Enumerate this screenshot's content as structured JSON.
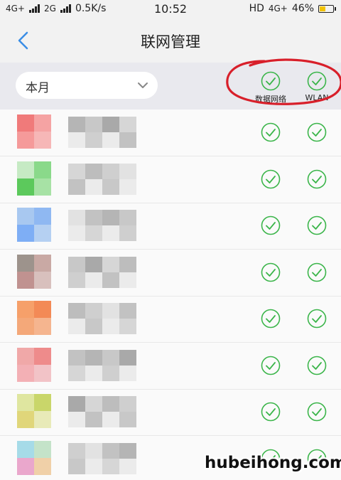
{
  "status_bar": {
    "network1": "4G+",
    "network2": "2G",
    "speed": "0.5K/s",
    "time": "10:52",
    "hd": "HD",
    "network3": "4G+",
    "battery_percent": "46%",
    "battery_level": 0.46
  },
  "header": {
    "back_icon": "chevron-left-icon",
    "title": "联网管理"
  },
  "filter": {
    "period_value": "本月",
    "columns": [
      {
        "label": "数据网络",
        "checked": true
      },
      {
        "label": "WLAN",
        "checked": true
      }
    ]
  },
  "apps": {
    "name_hidden": true,
    "rows": [
      {
        "data_allowed": true,
        "wlan_allowed": true
      },
      {
        "data_allowed": true,
        "wlan_allowed": true
      },
      {
        "data_allowed": true,
        "wlan_allowed": true
      },
      {
        "data_allowed": true,
        "wlan_allowed": true
      },
      {
        "data_allowed": true,
        "wlan_allowed": true
      },
      {
        "data_allowed": true,
        "wlan_allowed": true
      },
      {
        "data_allowed": true,
        "wlan_allowed": true
      },
      {
        "data_allowed": true,
        "wlan_allowed": true
      }
    ]
  },
  "colors": {
    "accent_green": "#3bb54a",
    "back_blue": "#3a8ee6",
    "annotation_red": "#d81f2a",
    "battery_yellow": "#f2c300"
  },
  "watermark": "hubeihong.com"
}
